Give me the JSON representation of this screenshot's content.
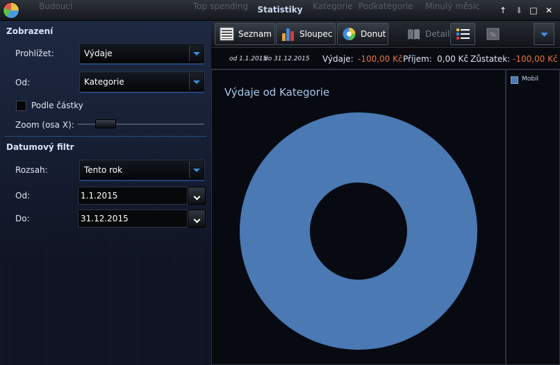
{
  "window": {
    "title": "Statistiky"
  },
  "ghost_tabs": [
    "Budoucí",
    "Top spending",
    "Kategorie",
    "Podkategorie",
    "Minulý měsíc"
  ],
  "window_buttons": {
    "up": "↑",
    "down": "⬇",
    "maximize": "□",
    "close": "✕"
  },
  "sidebar": {
    "view_section": "Zobrazení",
    "browse_label": "Prohlížet:",
    "browse_value": "Výdaje",
    "from_label": "Od:",
    "from_value": "Kategorie",
    "by_amount_label": "Podle částky",
    "zoom_label": "Zoom (osa X):",
    "zoom_value": 0.14,
    "date_section": "Datumový filtr",
    "range_label": "Rozsah:",
    "range_value": "Tento rok",
    "date_from_label": "Od:",
    "date_from_value": "1.1.2015",
    "date_to_label": "Do:",
    "date_to_value": "31.12.2015"
  },
  "toolbar": {
    "list_label": "Seznam",
    "column_label": "Sloupec",
    "donut_label": "Donut",
    "detail_label": "Detail"
  },
  "info": {
    "range_from": "od 1.1.2015",
    "range_to": "do 31.12.2015",
    "expense_label": "Výdaje:",
    "expense_value": "-100,00 Kč",
    "income_label": "Příjem:",
    "income_value": "0,00 Kč",
    "balance_label": "Zůstatek:",
    "balance_value": "-100,00 Kč"
  },
  "chart_data": {
    "type": "pie",
    "title": "Výdaje od Kategorie",
    "categories": [
      "Mobil"
    ],
    "values": [
      100
    ],
    "colors": [
      "#4a79b4"
    ],
    "donut": true,
    "legend": "right"
  },
  "colors": {
    "accent": "#3f8fe0",
    "negative": "#e8763a",
    "series": "#4a79b4"
  }
}
